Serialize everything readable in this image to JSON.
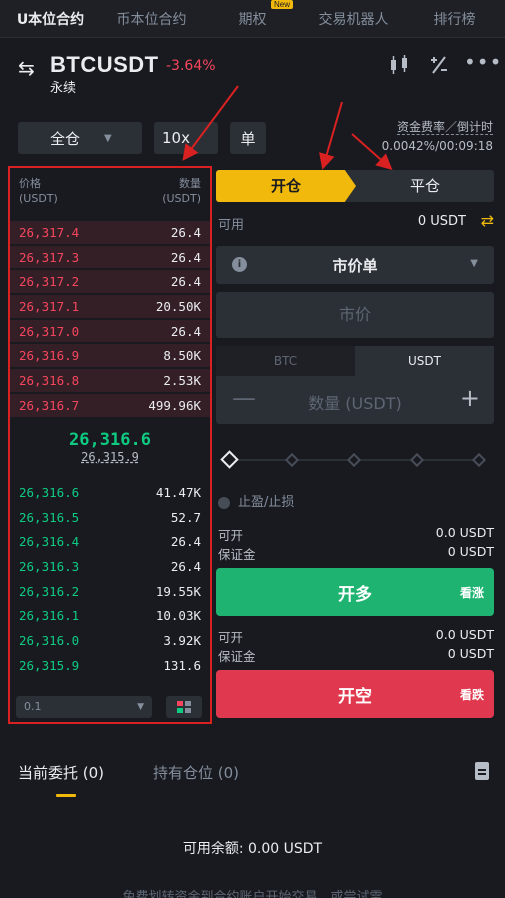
{
  "top_tabs": [
    {
      "label": "U本位合约",
      "active": true
    },
    {
      "label": "币本位合约",
      "active": false
    },
    {
      "label": "期权",
      "active": false,
      "badge": "New"
    },
    {
      "label": "交易机器人",
      "active": false
    },
    {
      "label": "排行榜",
      "active": false
    }
  ],
  "header": {
    "symbol": "BTCUSDT",
    "change": "-3.64%",
    "subtitle": "永续"
  },
  "mode": {
    "margin_mode": "全仓",
    "leverage": "10x",
    "position_mode": "单"
  },
  "funding": {
    "label": "资金费率／倒计时",
    "value": "0.0042%/00:09:18"
  },
  "orderbook": {
    "price_header": "价格",
    "price_unit": "(USDT)",
    "qty_header": "数量",
    "qty_unit": "(USDT)",
    "asks": [
      {
        "price": "26,317.4",
        "qty": "26.4"
      },
      {
        "price": "26,317.3",
        "qty": "26.4"
      },
      {
        "price": "26,317.2",
        "qty": "26.4"
      },
      {
        "price": "26,317.1",
        "qty": "20.50K"
      },
      {
        "price": "26,317.0",
        "qty": "26.4"
      },
      {
        "price": "26,316.9",
        "qty": "8.50K"
      },
      {
        "price": "26,316.8",
        "qty": "2.53K"
      },
      {
        "price": "26,316.7",
        "qty": "499.96K"
      }
    ],
    "last_price": "26,316.6",
    "mark_price": "26,315.9",
    "bids": [
      {
        "price": "26,316.6",
        "qty": "41.47K"
      },
      {
        "price": "26,316.5",
        "qty": "52.7"
      },
      {
        "price": "26,316.4",
        "qty": "26.4"
      },
      {
        "price": "26,316.3",
        "qty": "26.4"
      },
      {
        "price": "26,316.2",
        "qty": "19.55K"
      },
      {
        "price": "26,316.1",
        "qty": "10.03K"
      },
      {
        "price": "26,316.0",
        "qty": "3.92K"
      },
      {
        "price": "26,315.9",
        "qty": "131.6"
      }
    ],
    "precision": "0.1"
  },
  "trade": {
    "tab_open": "开仓",
    "tab_close": "平仓",
    "available_label": "可用",
    "available_value": "0 USDT",
    "order_type": "市价单",
    "price_placeholder": "市价",
    "unit_btc": "BTC",
    "unit_usdt": "USDT",
    "amount_placeholder": "数量 (USDT)",
    "minus": "—",
    "plus": "+",
    "tpsl_label": "止盈/止损",
    "long_open_label": "可开",
    "long_open_value": "0.0 USDT",
    "long_margin_label": "保证金",
    "long_margin_value": "0 USDT",
    "long_button": "开多",
    "long_sub": "看涨",
    "short_open_label": "可开",
    "short_open_value": "0.0 USDT",
    "short_margin_label": "保证金",
    "short_margin_value": "0 USDT",
    "short_button": "开空",
    "short_sub": "看跌"
  },
  "bottom": {
    "tab_orders": "当前委托 (0)",
    "tab_positions": "持有仓位 (0)",
    "balance": "可用余额: 0.00 USDT",
    "footnote": "免费划转资金到合约账户开始交易，或尝试雷"
  },
  "colors": {
    "accent": "#f0b90b",
    "up": "#0ecb81",
    "down": "#f6465d",
    "annotation": "#d92121"
  },
  "icons": [
    "swap-icon",
    "candlestick-icon",
    "calculator-icon",
    "more-icon",
    "transfer-icon",
    "info-icon",
    "layout-icon",
    "document-icon"
  ]
}
